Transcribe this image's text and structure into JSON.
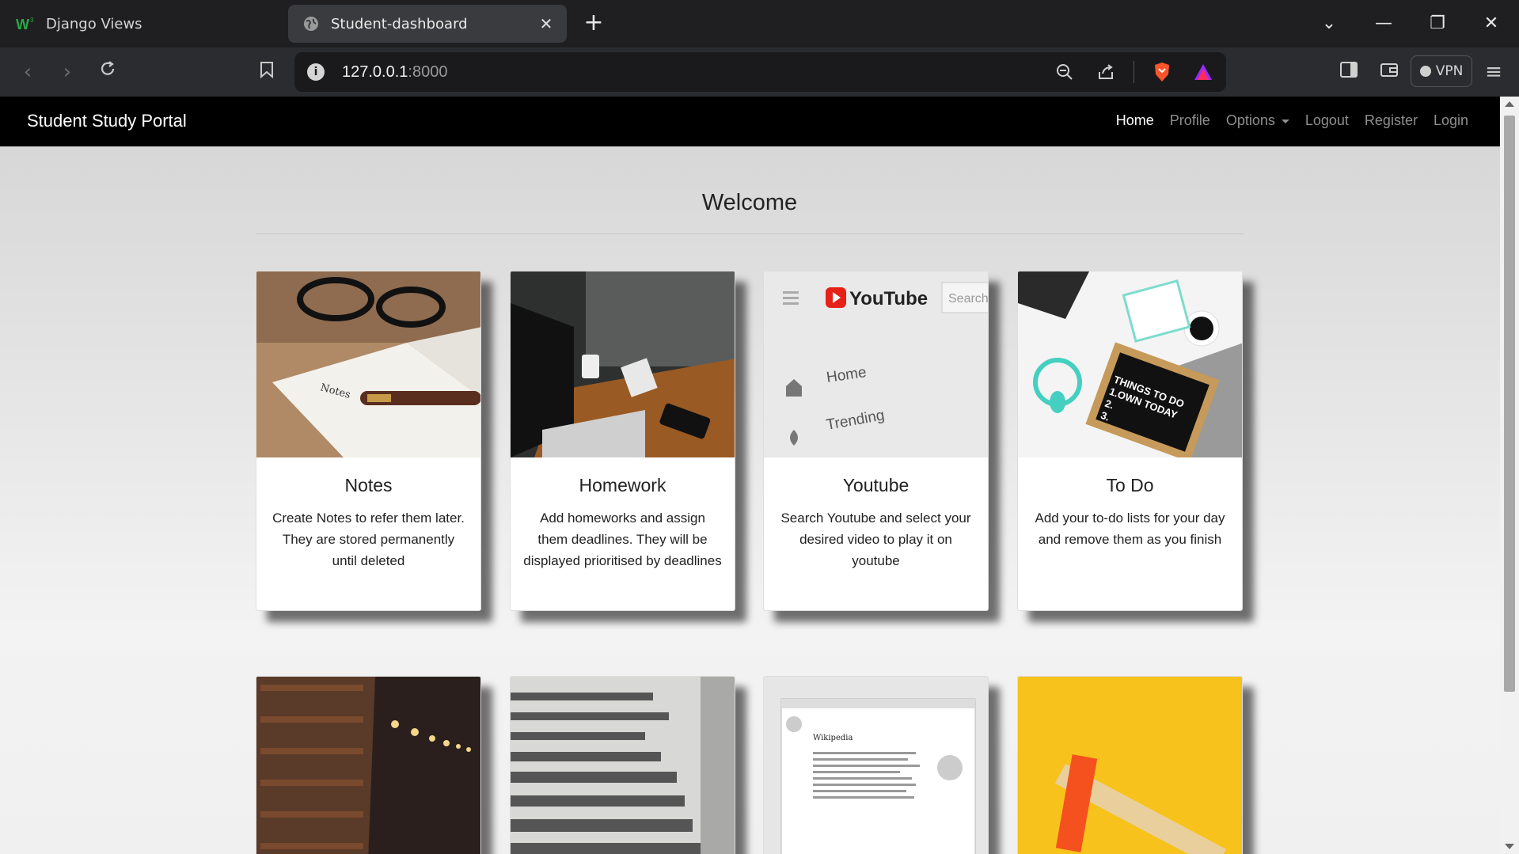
{
  "browser": {
    "tabs": [
      {
        "label": "Django Views",
        "active": false
      },
      {
        "label": "Student-dashboard",
        "active": true
      }
    ],
    "url_host": "127.0.0.1",
    "url_port": ":8000",
    "vpn_label": "VPN"
  },
  "site": {
    "brand": "Student Study Portal",
    "nav": [
      {
        "label": "Home",
        "active": true
      },
      {
        "label": "Profile"
      },
      {
        "label": "Options"
      },
      {
        "label": "Logout"
      },
      {
        "label": "Register"
      },
      {
        "label": "Login"
      }
    ],
    "heading": "Welcome"
  },
  "cards": [
    {
      "title": "Notes",
      "text": "Create Notes to refer them later. They are stored permanently until deleted"
    },
    {
      "title": "Homework",
      "text": "Add homeworks and assign them deadlines. They will be displayed prioritised by deadlines"
    },
    {
      "title": "Youtube",
      "text": "Search Youtube and select your desired video to play it on youtube"
    },
    {
      "title": "To Do",
      "text": "Add your to-do lists for your day and remove them as you finish"
    }
  ],
  "thumb_text": {
    "youtube_logo": "YouTube",
    "youtube_search": "Search",
    "youtube_home": "Home",
    "youtube_trending": "Trending",
    "todo_board": "THINGS TO DO\n1.OWN TODAY\n2.\n3.",
    "notes_label": "Notes",
    "wiki_title": "Wikipedia"
  },
  "colors": {
    "navbar_bg": "#000000",
    "tab_active_bg": "#3a3b3e",
    "brave_orange": "#fb542b"
  }
}
